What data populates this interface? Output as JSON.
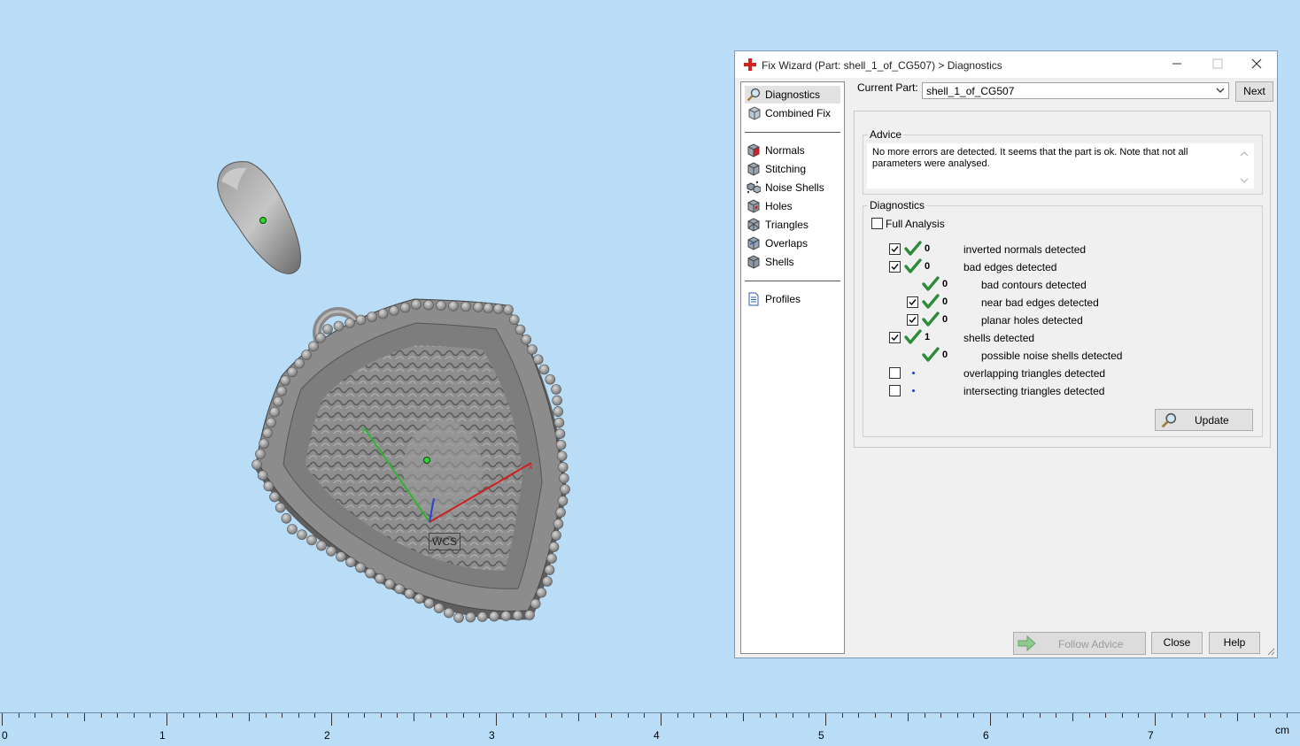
{
  "viewport": {
    "coord_label": "WCS",
    "axis_colors": {
      "x": "#d01e1e",
      "y": "#32b232",
      "z": "#2a3fd6"
    }
  },
  "ruler": {
    "labels": [
      "0",
      "1",
      "2",
      "3",
      "4",
      "5",
      "6",
      "7"
    ],
    "unit": "cm"
  },
  "dialog": {
    "title": "Fix Wizard (Part: shell_1_of_CG507) > Diagnostics",
    "nav": {
      "top_items": [
        {
          "label": "Diagnostics",
          "icon": "magnifier-icon",
          "selected": true
        },
        {
          "label": "Combined Fix",
          "icon": "cube-icon"
        }
      ],
      "fix_items": [
        {
          "label": "Normals",
          "icon": "normals-cube-icon"
        },
        {
          "label": "Stitching",
          "icon": "stitching-cube-icon"
        },
        {
          "label": "Noise Shells",
          "icon": "noise-shells-icon"
        },
        {
          "label": "Holes",
          "icon": "holes-cube-icon"
        },
        {
          "label": "Triangles",
          "icon": "triangles-cube-icon"
        },
        {
          "label": "Overlaps",
          "icon": "overlaps-cube-icon"
        },
        {
          "label": "Shells",
          "icon": "shells-cube-icon"
        }
      ],
      "bottom_items": [
        {
          "label": "Profiles",
          "icon": "document-icon"
        }
      ]
    },
    "current_part_label": "Current Part:",
    "current_part_value": "shell_1_of_CG507",
    "next_label": "Next",
    "advice": {
      "title": "Advice",
      "text": "No more errors are detected. It seems that the part is ok. Note that not all parameters were analysed."
    },
    "diagnostics": {
      "title": "Diagnostics",
      "full_analysis_label": "Full Analysis",
      "full_analysis_checked": false,
      "rows": [
        {
          "checkbox": true,
          "checked": true,
          "status": "ok",
          "count": "0",
          "label": "inverted normals detected",
          "indent": 0
        },
        {
          "checkbox": true,
          "checked": true,
          "status": "ok",
          "count": "0",
          "label": "bad edges detected",
          "indent": 0
        },
        {
          "checkbox": false,
          "checked": false,
          "status": "ok",
          "count": "0",
          "label": "bad contours detected",
          "indent": 1
        },
        {
          "checkbox": true,
          "checked": true,
          "status": "ok",
          "count": "0",
          "label": "near bad edges detected",
          "indent": 1
        },
        {
          "checkbox": true,
          "checked": true,
          "status": "ok",
          "count": "0",
          "label": "planar holes detected",
          "indent": 1
        },
        {
          "checkbox": true,
          "checked": true,
          "status": "ok",
          "count": "1",
          "label": "shells detected",
          "indent": 0
        },
        {
          "checkbox": false,
          "checked": false,
          "status": "ok",
          "count": "0",
          "label": "possible noise shells detected",
          "indent": 1
        },
        {
          "checkbox": true,
          "checked": false,
          "status": "none",
          "count": "",
          "label": "overlapping triangles detected",
          "indent": 0
        },
        {
          "checkbox": true,
          "checked": false,
          "status": "none",
          "count": "",
          "label": "intersecting triangles detected",
          "indent": 0
        }
      ],
      "update_label": "Update"
    },
    "follow_advice_label": "Follow Advice",
    "close_label": "Close",
    "help_label": "Help"
  }
}
